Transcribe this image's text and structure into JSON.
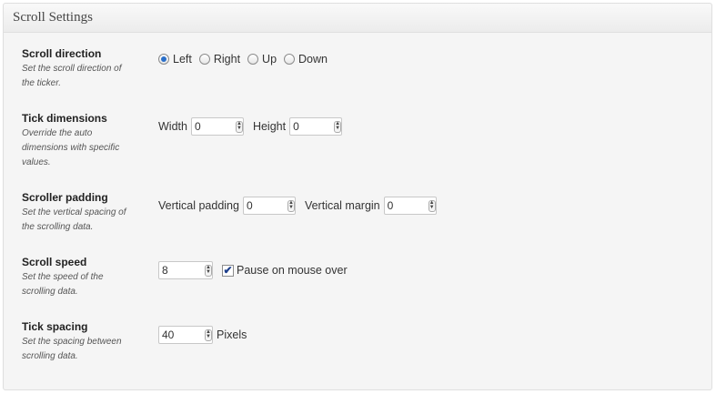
{
  "panel": {
    "title": "Scroll Settings"
  },
  "direction": {
    "title": "Scroll direction",
    "desc_lines": [
      "Set the scroll direction of",
      "the ticker."
    ],
    "options": [
      {
        "label": "Left",
        "checked": true
      },
      {
        "label": "Right",
        "checked": false
      },
      {
        "label": "Up",
        "checked": false
      },
      {
        "label": "Down",
        "checked": false
      }
    ]
  },
  "dimensions": {
    "title": "Tick dimensions",
    "desc_lines": [
      "Override the auto",
      "dimensions with specific",
      "values."
    ],
    "width_label": "Width",
    "width_value": "0",
    "height_label": "Height",
    "height_value": "0"
  },
  "padding": {
    "title": "Scroller padding",
    "desc_lines": [
      "Set the vertical spacing of",
      "the scrolling data."
    ],
    "vpad_label": "Vertical padding",
    "vpad_value": "0",
    "vmargin_label": "Vertical margin",
    "vmargin_value": "0"
  },
  "speed": {
    "title": "Scroll speed",
    "desc_lines": [
      "Set the speed of the",
      "scrolling data."
    ],
    "value": "8",
    "pause_label": "Pause on mouse over",
    "pause_checked": true
  },
  "spacing": {
    "title": "Tick spacing",
    "desc_lines": [
      "Set the spacing between",
      "scrolling data."
    ],
    "value": "40",
    "unit": "Pixels"
  }
}
